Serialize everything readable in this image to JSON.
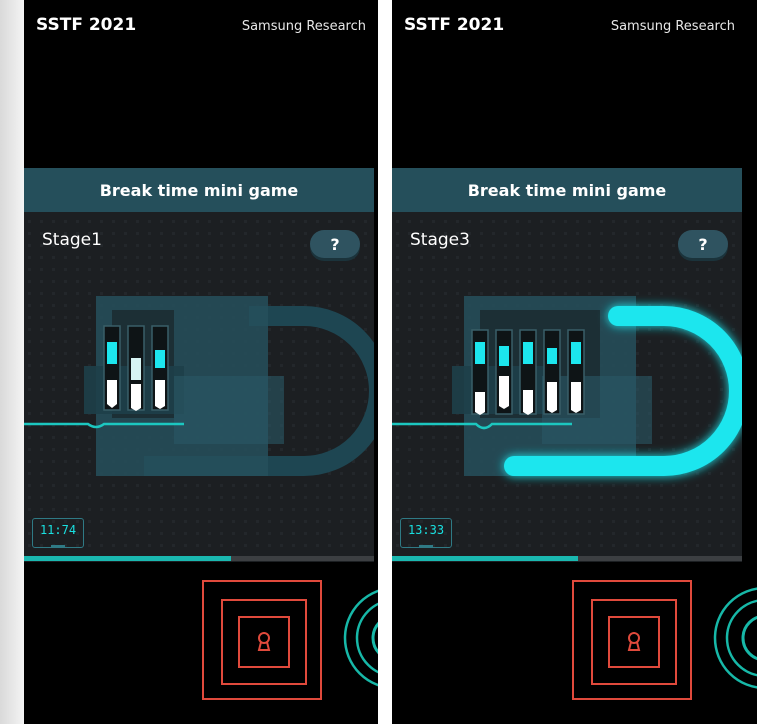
{
  "panels": [
    {
      "brand": "SSTF 2021",
      "org": "Samsung Research",
      "game_title": "Break time mini game",
      "stage": "Stage1",
      "help_label": "?",
      "timer": "11:74",
      "progress": 0.59,
      "lock_state": "locked",
      "pins": [
        {
          "top_glow": true,
          "top_color": "#1ce6ee",
          "bottom": "white"
        },
        {
          "top_glow": false,
          "top_color": "#d6f4f4",
          "bottom": "white"
        },
        {
          "top_glow": true,
          "top_color": "#1ce6ee",
          "bottom": "white"
        }
      ]
    },
    {
      "brand": "SSTF 2021",
      "org": "Samsung Research",
      "game_title": "Break time mini game",
      "stage": "Stage3",
      "help_label": "?",
      "timer": "13:33",
      "progress": 0.53,
      "lock_state": "unlocked",
      "pins": [
        {
          "top_glow": true,
          "top_color": "#1ce6ee",
          "bottom": "white"
        },
        {
          "top_glow": true,
          "top_color": "#1ce6ee",
          "bottom": "white"
        },
        {
          "top_glow": true,
          "top_color": "#1ce6ee",
          "bottom": "white"
        },
        {
          "top_glow": true,
          "top_color": "#1ce6ee",
          "bottom": "white"
        },
        {
          "top_glow": true,
          "top_color": "#1ce6ee",
          "bottom": "white"
        }
      ]
    }
  ],
  "colors": {
    "accent": "#1ce6ee",
    "lock_body": "#26505c",
    "lock_dark": "#1e3f49",
    "button_red": "#e04a3c",
    "dial_teal": "#17b8a8"
  },
  "icons": {
    "help": "question-mark",
    "lock_button": "keyhole-icon",
    "dial": "concentric-circles"
  }
}
